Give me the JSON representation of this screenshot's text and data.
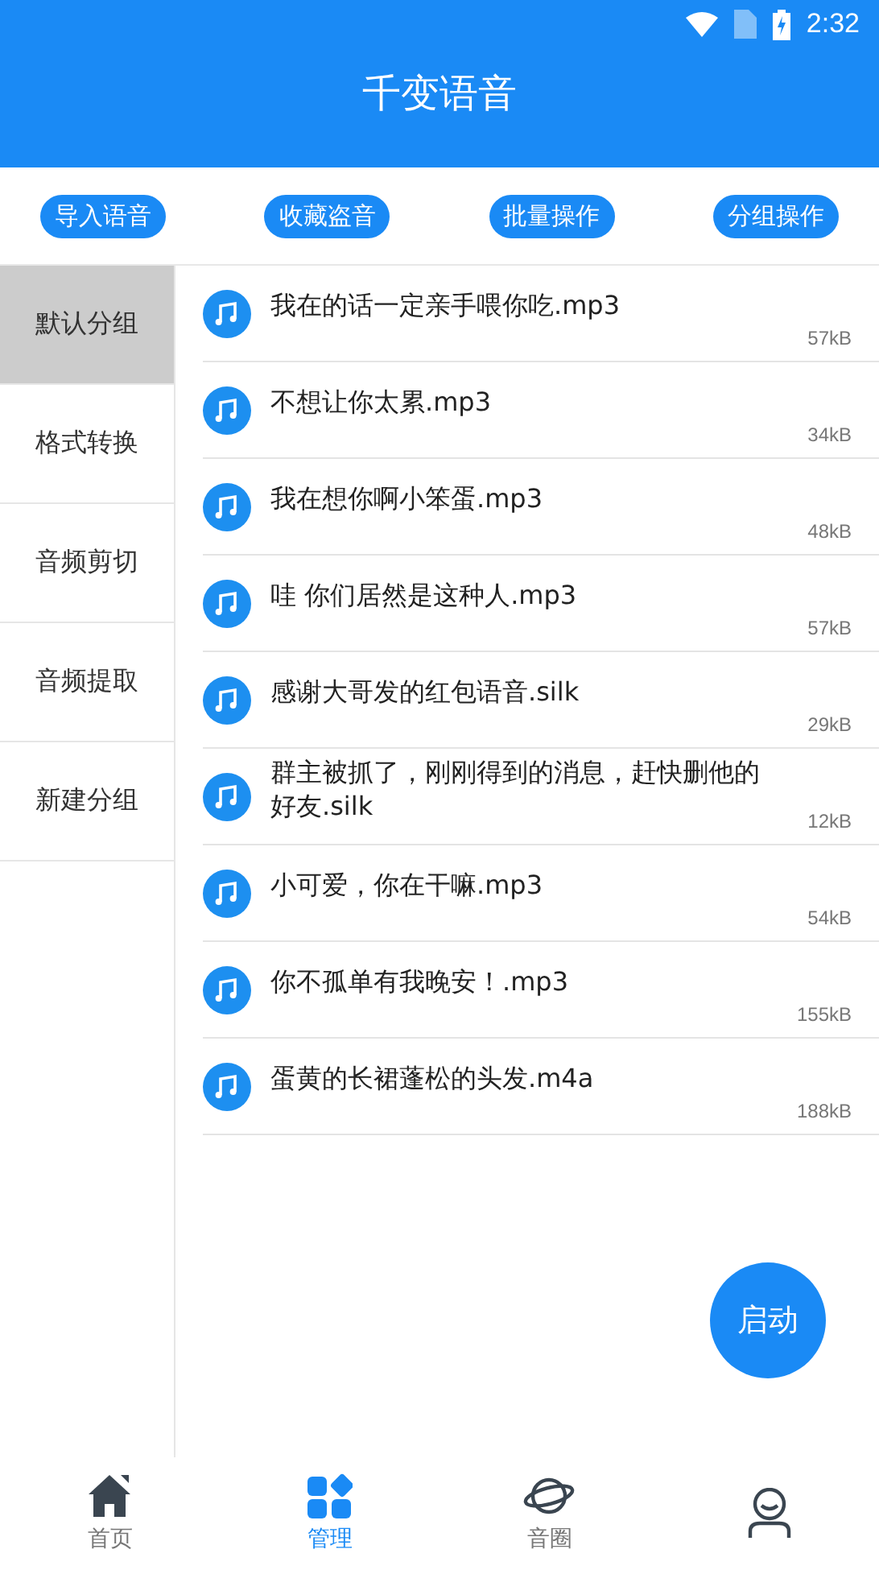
{
  "status_bar": {
    "time": "2:32"
  },
  "header": {
    "title": "千变语音"
  },
  "actions": [
    "导入语音",
    "收藏盗音",
    "批量操作",
    "分组操作"
  ],
  "sidebar": {
    "items": [
      {
        "label": "默认分组",
        "selected": true
      },
      {
        "label": "格式转换",
        "selected": false
      },
      {
        "label": "音频剪切",
        "selected": false
      },
      {
        "label": "音频提取",
        "selected": false
      },
      {
        "label": "新建分组",
        "selected": false
      }
    ]
  },
  "files": [
    {
      "name": "我在的话一定亲手喂你吃.mp3",
      "size": "57kB"
    },
    {
      "name": "不想让你太累.mp3",
      "size": "34kB"
    },
    {
      "name": "我在想你啊小笨蛋.mp3",
      "size": "48kB"
    },
    {
      "name": "哇 你们居然是这种人.mp3",
      "size": "57kB"
    },
    {
      "name": "感谢大哥发的红包语音.silk",
      "size": "29kB"
    },
    {
      "name": "群主被抓了，刚刚得到的消息，赶快删他的好友.silk",
      "size": "12kB"
    },
    {
      "name": "小可爱，你在干嘛.mp3",
      "size": "54kB"
    },
    {
      "name": "你不孤单有我晚安！.mp3",
      "size": "155kB"
    },
    {
      "name": "蛋黄的长裙蓬松的头发.m4a",
      "size": "188kB"
    }
  ],
  "fab": {
    "label": "启动"
  },
  "bottom_nav": [
    {
      "kind": "home",
      "label": "首页",
      "selected": false
    },
    {
      "kind": "manage",
      "label": "管理",
      "selected": true
    },
    {
      "kind": "planet",
      "label": "音圈",
      "selected": false
    },
    {
      "kind": "person",
      "selected": false
    }
  ]
}
